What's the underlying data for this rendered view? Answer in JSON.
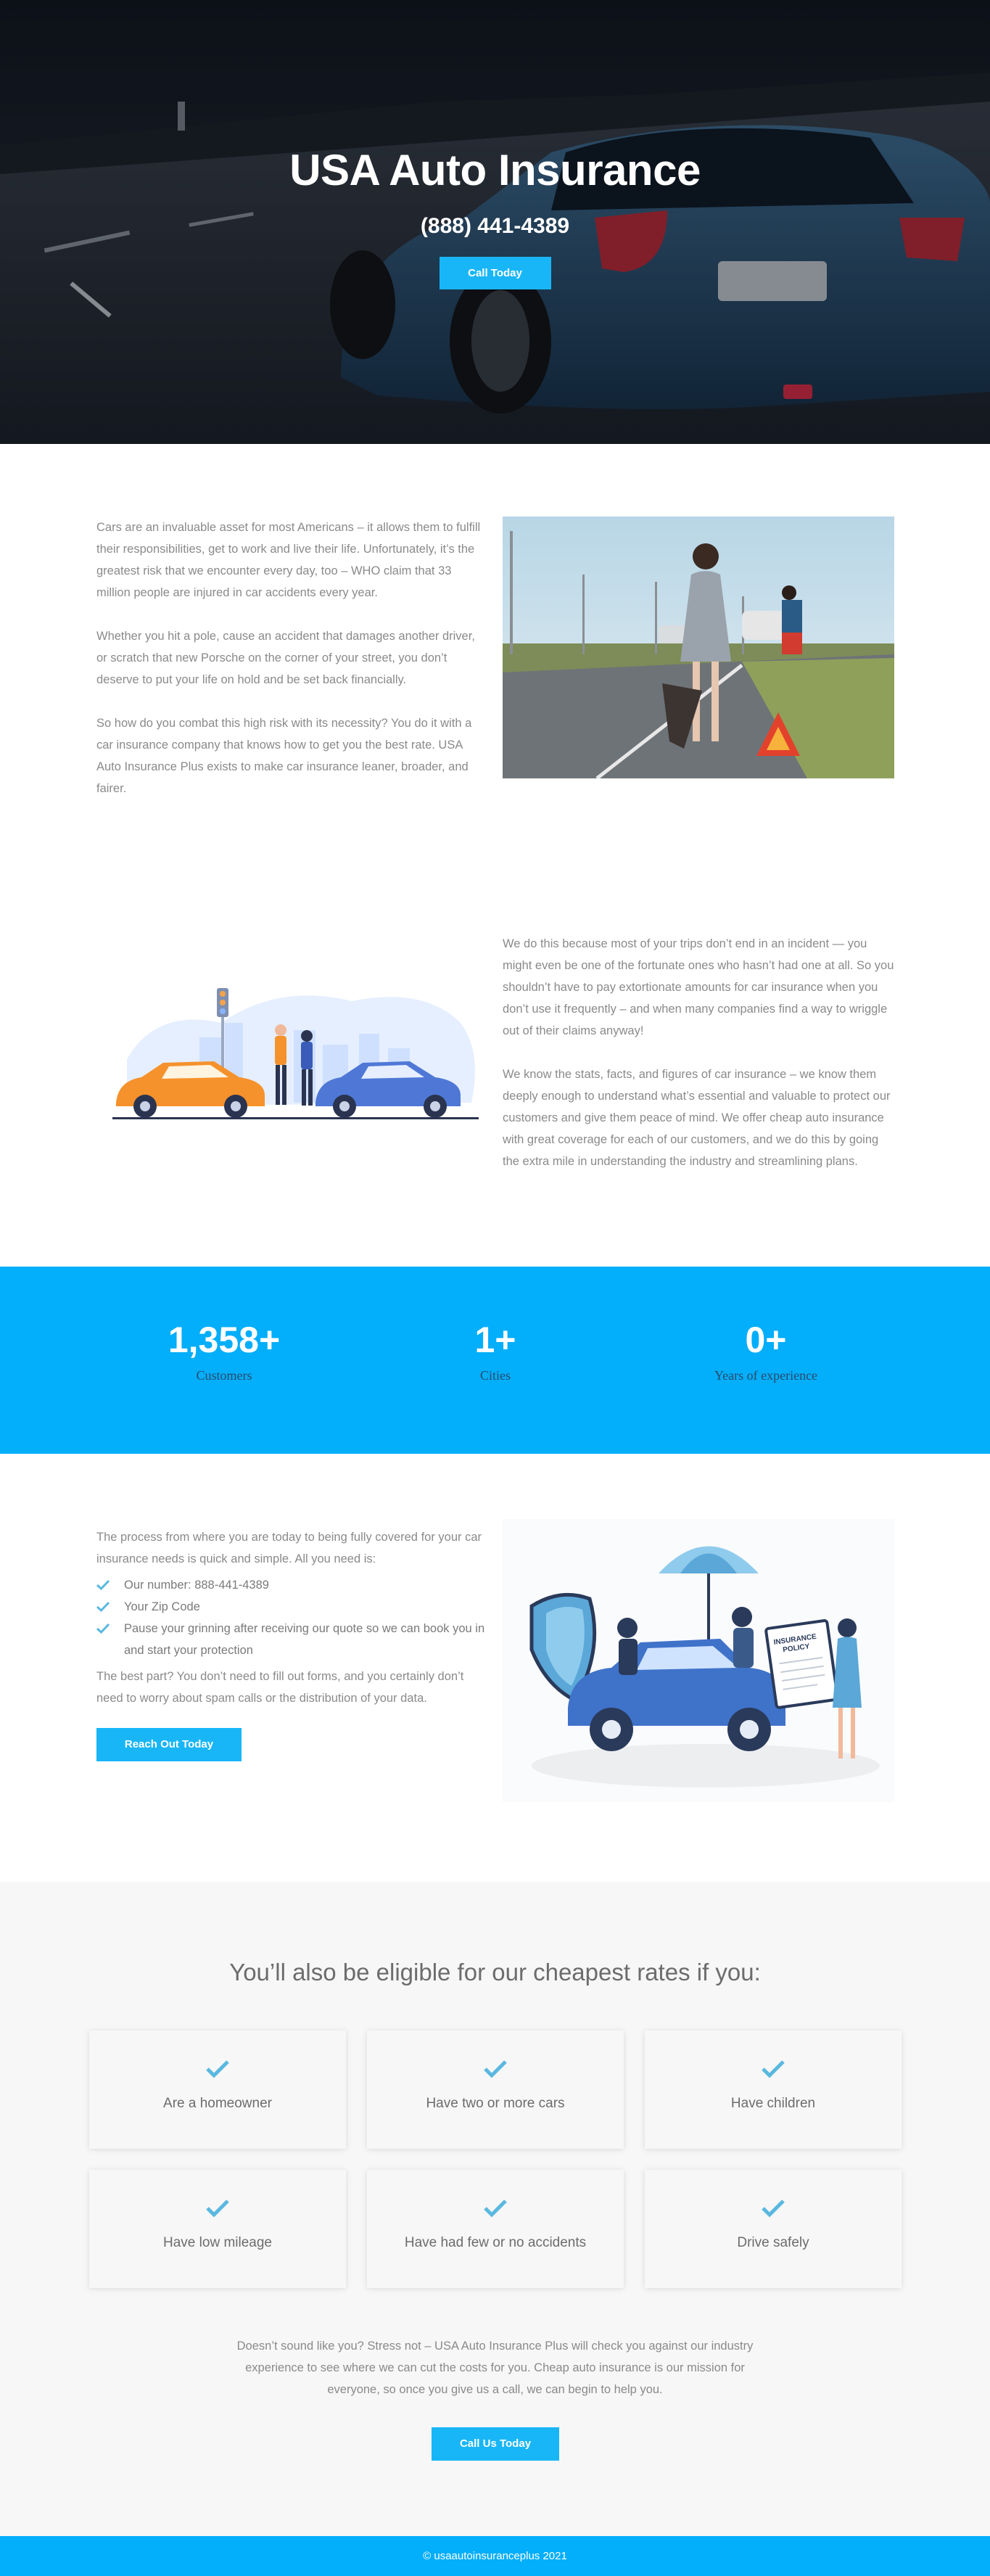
{
  "hero": {
    "title": "USA Auto Insurance",
    "phone": "(888) 441-4389",
    "cta_label": "Call Today"
  },
  "about": {
    "paragraphs": [
      "Cars are an invaluable asset for most Americans – it allows them to fulfill their responsibilities, get to work and live their life. Unfortunately, it’s the greatest risk that we encounter every day, too – WHO claim that 33 million people are injured in car accidents every year.",
      "Whether you hit a pole, cause an accident that damages another driver, or scratch that new Porsche on the corner of your street, you don’t deserve to put your life on hold and be set back financially.",
      "So how do you combat this high risk with its necessity? You do it with a car insurance company that knows how to get you the best rate. USA Auto Insurance Plus exists to make car insurance leaner, broader, and fairer."
    ]
  },
  "why": {
    "paragraphs": [
      "We do this because most of your trips don’t end in an incident —  you might even be one of the fortunate ones who hasn’t had one at all. So you shouldn’t have to pay extortionate amounts for car insurance when you don’t use it frequently – and when many companies find a way to wriggle out of their claims anyway!",
      "We know the stats, facts, and figures of car insurance – we know them deeply enough to understand what’s essential and valuable to protect our customers and give them peace of mind. We offer cheap auto insurance with great coverage for each of our customers, and we do this by going the extra mile in understanding the industry and streamlining plans."
    ]
  },
  "stats": [
    {
      "value": "1,358+",
      "label": "Customers"
    },
    {
      "value": "1+",
      "label": "Cities"
    },
    {
      "value": "0+",
      "label": "Years of experience"
    }
  ],
  "process": {
    "intro": "The process from where you are today to being fully covered for your car insurance needs is quick and simple. All you need is:",
    "items": [
      "Our number: 888-441-4389",
      "Your Zip Code",
      "Pause your grinning after receiving our quote so we can book you in and start your protection"
    ],
    "outro": "The best part? You don’t need to fill out forms, and you certainly don’t need to worry about spam calls or the distribution of your data.",
    "cta_label": "Reach Out Today",
    "policy_label_1": "INSURANCE",
    "policy_label_2": "POLICY"
  },
  "eligible": {
    "heading": "You’ll also be eligible for our cheapest rates if you:",
    "cards": [
      "Are a homeowner",
      "Have two or more cars",
      "Have children",
      "Have low mileage",
      "Have had few or no accidents",
      "Drive safely"
    ],
    "note": "Doesn’t sound like you? Stress not – USA Auto Insurance Plus will check you against our industry experience to see where we can cut the costs for you. Cheap auto insurance is our mission for everyone, so once you give us a call, we can begin to help you.",
    "cta_label": "Call Us Today"
  },
  "footer": {
    "text": "© usaautoinsuranceplus 2021"
  },
  "colors": {
    "accent": "#18b6f6",
    "stats_bg": "#03aefa",
    "check": "#5ab8e0"
  },
  "icons": [
    "check-icon"
  ]
}
